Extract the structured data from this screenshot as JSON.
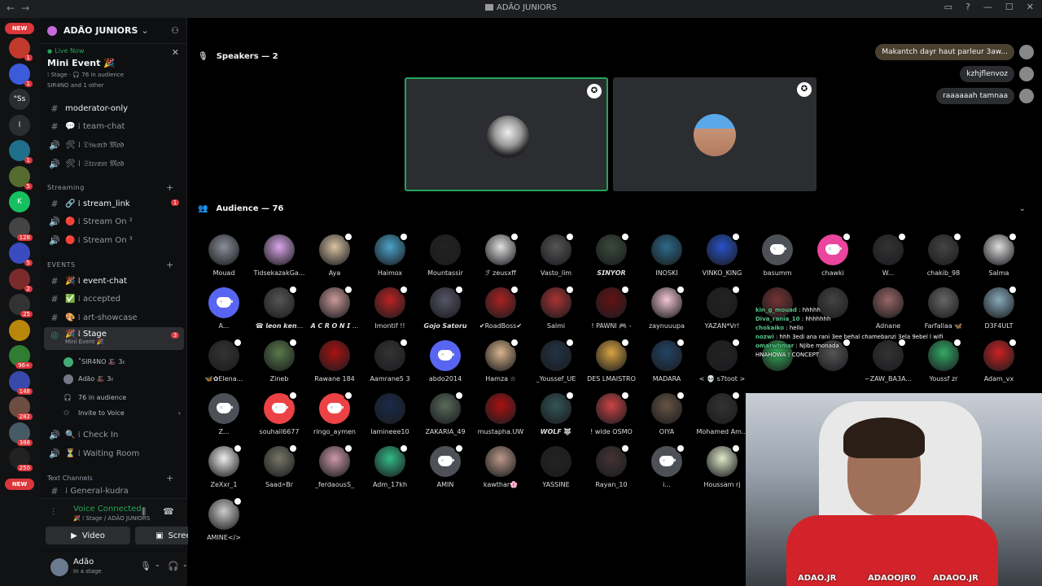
{
  "window": {
    "title": "ADÃO JUNIORS"
  },
  "rail": {
    "new_top": "NEW",
    "new_bottom": "NEW",
    "items": [
      {
        "label": "",
        "badge": "1"
      },
      {
        "label": "",
        "badge": "1"
      },
      {
        "label": "\"Ss",
        "badge": ""
      },
      {
        "label": "l",
        "badge": ""
      },
      {
        "label": "",
        "badge": "1"
      },
      {
        "label": "",
        "badge": "5"
      },
      {
        "label": "K",
        "badge": ""
      },
      {
        "label": "",
        "badge": "128"
      },
      {
        "label": "",
        "badge": "5"
      },
      {
        "label": "",
        "badge": "2"
      },
      {
        "label": "",
        "badge": "25"
      },
      {
        "label": "",
        "badge": ""
      },
      {
        "label": "",
        "badge": "96+"
      },
      {
        "label": "",
        "badge": "148"
      },
      {
        "label": "",
        "badge": "282"
      },
      {
        "label": "",
        "badge": "388"
      },
      {
        "label": "",
        "badge": "250"
      }
    ]
  },
  "server": {
    "name": "ADÃO JUNIORS"
  },
  "live_event": {
    "status": "Live Now",
    "name": "Mini Event 🎉",
    "meta1": "⁞ Stage · 🎧 76 in audience",
    "meta2": "SIR4NO and 1 other"
  },
  "channels_top": [
    {
      "icon": "#",
      "label": "moderator-only",
      "bright": true
    },
    {
      "icon": "#",
      "label": "💬 ⁞ team-chat",
      "bright": false
    },
    {
      "icon": "🔊",
      "label": "🛠 ⁞ 𝔇𝔦𝔰𝔠𝔬𝔯𝔡 𝔐𝔬𝔡",
      "bright": false
    },
    {
      "icon": "🔊",
      "label": "🛠 ⁞ 𝔖𝔱𝔯𝔢𝔞𝔪 𝔐𝔬𝔡",
      "bright": false
    }
  ],
  "cat_streaming": "Streaming",
  "channels_streaming": [
    {
      "icon": "#",
      "label": "🔗 ⁞ stream_link",
      "badge": "1",
      "bright": true
    },
    {
      "icon": "🔊",
      "label": "🔴 ⁞ Stream On ²",
      "badge": "",
      "bright": false
    },
    {
      "icon": "🔊",
      "label": "🔴 ⁞ Stream On ³",
      "badge": "",
      "bright": false
    }
  ],
  "cat_events": "EVENTS",
  "channels_events": [
    {
      "icon": "#",
      "label": "🎉 ⁞ event-chat",
      "bright": true
    },
    {
      "icon": "#",
      "label": "✅ ⁞ accepted",
      "bright": false
    },
    {
      "icon": "#",
      "label": "🎨 ⁞ art-showcase",
      "bright": false
    }
  ],
  "stage_channel": {
    "label": "🎉 ⁞ Stage",
    "sub": "Mini Event 🎉",
    "badge": "3"
  },
  "stage_members": [
    {
      "name": "˚SIR4NO 🎩 3𝔢"
    },
    {
      "name": "Adão 🎩 3𝔢"
    }
  ],
  "stage_audience": "76 in audience",
  "invite_voice": "Invite to Voice",
  "channels_after": [
    {
      "icon": "🔊",
      "label": "🔍 ⁞ Check In"
    },
    {
      "icon": "🔊",
      "label": "⏳ ⁞ Waiting Room"
    }
  ],
  "cat_text": "Text Channels",
  "partial_channel": "⁞ General-kudra",
  "voice": {
    "status": "Voice Connected",
    "location": "🎉 ⁞ Stage / ADÃO JUNIORS",
    "video_label": "Video",
    "screen_label": "Screen"
  },
  "user": {
    "name": "Adão",
    "status": "In a stage"
  },
  "stage": {
    "speakers_header": "Speakers — 2",
    "audience_header": "Audience — 76"
  },
  "bubbles": [
    {
      "text": "Makantch dayr haut parleur 3aw..."
    },
    {
      "text": "kzhjflenvoz"
    },
    {
      "text": "raaaaaah tamnaa"
    }
  ],
  "audience": [
    {
      "name": "Mouad",
      "type": "photo",
      "color": "#8a8f99",
      "mod": false
    },
    {
      "name": "TidsekazakGa...",
      "type": "photo",
      "color": "#d9a6e8",
      "mod": false
    },
    {
      "name": "Aya",
      "type": "photo",
      "color": "#d9c3a3",
      "mod": true
    },
    {
      "name": "Haimox",
      "type": "photo",
      "color": "#4aa3c9",
      "mod": true
    },
    {
      "name": "Mountassir",
      "type": "photo",
      "color": "#222",
      "mod": false
    },
    {
      "name": "ℱ zeusxff",
      "type": "photo",
      "color": "#e0e0e0",
      "mod": true
    },
    {
      "name": "Vasto_lim",
      "type": "photo",
      "color": "#555",
      "mod": true
    },
    {
      "name": "𝙎𝙄𝙉𝙔𝙊𝙍",
      "type": "photo",
      "color": "#3b4a3b",
      "mod": true
    },
    {
      "name": "INOSKI",
      "type": "photo",
      "color": "#2d6a8a",
      "mod": false
    },
    {
      "name": "VINKO_KING",
      "type": "photo",
      "color": "#2752c9",
      "mod": true
    },
    {
      "name": "basumm",
      "type": "discord",
      "color": "gray",
      "mod": false
    },
    {
      "name": "chawki",
      "type": "discord",
      "color": "pink",
      "mod": true
    },
    {
      "name": "W...",
      "type": "photo",
      "color": "#333",
      "mod": true
    },
    {
      "name": "chakib_98",
      "type": "photo",
      "color": "#444",
      "mod": true
    },
    {
      "name": "Salma",
      "type": "photo",
      "color": "#ddd",
      "mod": true
    },
    {
      "name": "A...",
      "type": "discord",
      "color": "blue",
      "mod": false
    },
    {
      "name": "☎ 𝙡𝙚𝙤𝙣 𝙠𝙚𝙣...",
      "type": "photo",
      "color": "#555",
      "mod": true
    },
    {
      "name": "𝘼 𝘾 𝙍 𝙊 𝙉 𝙄 ...",
      "type": "photo",
      "color": "#c99",
      "mod": true
    },
    {
      "name": "Imontif !!",
      "type": "photo",
      "color": "#b22",
      "mod": true
    },
    {
      "name": "𝙂𝙤𝙟𝙤 𝙎𝙖𝙩𝙤𝙧𝙪",
      "type": "photo",
      "color": "#556",
      "mod": true
    },
    {
      "name": "✔RoadBoss✔",
      "type": "photo",
      "color": "#a22",
      "mod": true
    },
    {
      "name": "Salmi",
      "type": "photo",
      "color": "#a33",
      "mod": true
    },
    {
      "name": "! PAWNI 🎮 -",
      "type": "photo",
      "color": "#611",
      "mod": true
    },
    {
      "name": "zaynuuupa",
      "type": "photo",
      "color": "#f4c6d4",
      "mod": true
    },
    {
      "name": "YAZAN*Vr!",
      "type": "photo",
      "color": "#222",
      "mod": true
    },
    {
      "name": "",
      "type": "photo",
      "color": "#733",
      "mod": false
    },
    {
      "name": "",
      "type": "photo",
      "color": "#444",
      "mod": false
    },
    {
      "name": "Adnane",
      "type": "photo",
      "color": "#966",
      "mod": false
    },
    {
      "name": "Farfallaa 🦋",
      "type": "photo",
      "color": "#666",
      "mod": false
    },
    {
      "name": "D3F4ULT",
      "type": "photo",
      "color": "#8ab",
      "mod": true
    },
    {
      "name": "🦋✿Elena...",
      "type": "photo",
      "color": "#333",
      "mod": true
    },
    {
      "name": "Zineb",
      "type": "photo",
      "color": "#5a7a4a",
      "mod": true
    },
    {
      "name": "Rawane 184",
      "type": "photo",
      "color": "#a11",
      "mod": false
    },
    {
      "name": "Aamrane5 3",
      "type": "photo",
      "color": "#333",
      "mod": true
    },
    {
      "name": "abdo2014",
      "type": "discord",
      "color": "blue",
      "mod": false
    },
    {
      "name": "Hamza ☆",
      "type": "photo",
      "color": "#d9b38c",
      "mod": true
    },
    {
      "name": "_Youssef_UE",
      "type": "photo",
      "color": "#234",
      "mod": true
    },
    {
      "name": "DES LMAISTRO",
      "type": "photo",
      "color": "#d9a441",
      "mod": true
    },
    {
      "name": "MADARA",
      "type": "photo",
      "color": "#246",
      "mod": true
    },
    {
      "name": "< 💀 s7toot >",
      "type": "photo",
      "color": "#222",
      "mod": true
    },
    {
      "name": "",
      "type": "photo",
      "color": "#3a5",
      "mod": false
    },
    {
      "name": "",
      "type": "photo",
      "color": "#555",
      "mod": true
    },
    {
      "name": "~ZAW_BA3A...",
      "type": "photo",
      "color": "#333",
      "mod": true
    },
    {
      "name": "Youssf zr",
      "type": "photo",
      "color": "#3a6",
      "mod": true
    },
    {
      "name": "Adam_vx",
      "type": "photo",
      "color": "#c22",
      "mod": true
    },
    {
      "name": "Z...",
      "type": "discord",
      "color": "gray",
      "mod": false
    },
    {
      "name": "souhail6677",
      "type": "discord",
      "color": "red",
      "mod": true
    },
    {
      "name": "ringo_aymen",
      "type": "discord",
      "color": "red",
      "mod": true
    },
    {
      "name": "lamineee10",
      "type": "photo",
      "color": "#1a2a4a",
      "mod": false
    },
    {
      "name": "ZAKARIA_49",
      "type": "photo",
      "color": "#5a6a5a",
      "mod": true
    },
    {
      "name": "mustapha.UW",
      "type": "photo",
      "color": "#a11",
      "mod": false
    },
    {
      "name": "𝙒𝙊𝙇𝙁 🐺",
      "type": "photo",
      "color": "#355",
      "mod": true
    },
    {
      "name": "! wlde OSMO",
      "type": "photo",
      "color": "#c44",
      "mod": true
    },
    {
      "name": "OIYA",
      "type": "photo",
      "color": "#654",
      "mod": true
    },
    {
      "name": "Mohamed Am...",
      "type": "photo",
      "color": "#333",
      "mod": true
    },
    {
      "name": "ZeXxr_1",
      "type": "photo",
      "color": "#eee",
      "mod": true
    },
    {
      "name": "Saad🗲Br",
      "type": "photo",
      "color": "#776",
      "mod": true
    },
    {
      "name": "_ferdaousS_",
      "type": "photo",
      "color": "#c9a",
      "mod": true
    },
    {
      "name": "Adm_17kh",
      "type": "photo",
      "color": "#3b8",
      "mod": true
    },
    {
      "name": "AMIN",
      "type": "discord",
      "color": "gray",
      "mod": true
    },
    {
      "name": "kawthar🌸",
      "type": "photo",
      "color": "#b98",
      "mod": false
    },
    {
      "name": "YASSINE",
      "type": "photo",
      "color": "#222",
      "mod": false
    },
    {
      "name": "Rayan_10",
      "type": "photo",
      "color": "#433",
      "mod": true
    },
    {
      "name": "i...",
      "type": "discord",
      "color": "gray",
      "mod": true
    },
    {
      "name": "Houssam rj",
      "type": "photo",
      "color": "#dfe8c9",
      "mod": true
    },
    {
      "name": "AMINE</>",
      "type": "photo",
      "color": "#ccc",
      "mod": true
    }
  ],
  "chat_overlay": [
    {
      "user": "kin_g_mouad",
      "text": "hhhhh"
    },
    {
      "user": "Diva_rania_10",
      "text": "hhhhhhh"
    },
    {
      "user": "chokaiko",
      "text": "hello"
    },
    {
      "user": "nozwi",
      "text": "hhh 3edi ana rani 3ee behal chamebanzi 3ela 9ebel l wifi"
    },
    {
      "user": "omarwhmar",
      "text": "Njibe monada"
    },
    {
      "user": "",
      "text": "HNAHOWA ! CONCEPT"
    }
  ],
  "socials": [
    "ADAO.JR",
    "ADAOOJR0",
    "ADAOO.JR"
  ],
  "colors": {
    "green": "#23a55a",
    "red": "#da373c",
    "blurple": "#5865f2"
  }
}
